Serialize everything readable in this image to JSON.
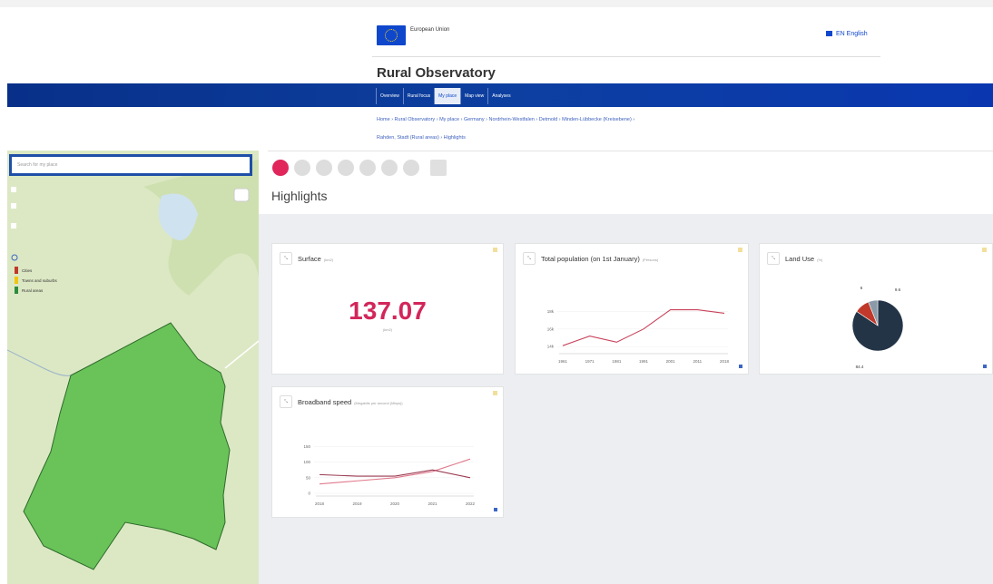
{
  "header": {
    "eu_label": "European Union",
    "language": "EN English",
    "site_title": "Rural Observatory"
  },
  "nav": {
    "items": [
      {
        "label": "Overview",
        "active": false
      },
      {
        "label": "Rural focus",
        "active": false
      },
      {
        "label": "My place",
        "active": true
      },
      {
        "label": "Map view",
        "active": false
      },
      {
        "label": "Analyses",
        "active": false
      }
    ]
  },
  "breadcrumb": {
    "line1": "Home › Rural Observatory › My place › Germany › Nordrhein-Westfalen › Detmold › Minden-Lübbecke (Kreisebene) ›",
    "line2": "Rahden, Stadt (Rural areas) › Highlights"
  },
  "search": {
    "placeholder": "Search for my place"
  },
  "map": {
    "legend": [
      {
        "label": "Cities",
        "color": "#c0392b"
      },
      {
        "label": "Towns and suburbs",
        "color": "#f1c40f"
      },
      {
        "label": "Rural areas",
        "color": "#2e8b3e"
      }
    ]
  },
  "section": {
    "title": "Highlights"
  },
  "cards": {
    "surface": {
      "title": "Surface",
      "unit": "(km2)",
      "value": "137.07",
      "value_unit": "(km2)"
    },
    "population": {
      "title": "Total population (on 1st January)",
      "unit": "(Persons)"
    },
    "landuse": {
      "title": "Land Use",
      "unit": "(%)"
    },
    "broadband": {
      "title": "Broadband speed",
      "unit": "(Megabits per second (Mbps))"
    }
  },
  "chart_data": [
    {
      "type": "line",
      "title": "Total population (on 1st January)",
      "ylabel": "",
      "x": [
        "1961",
        "1971",
        "1981",
        "1991",
        "2001",
        "2011",
        "2018"
      ],
      "series": [
        {
          "values": [
            14100,
            15200,
            14500,
            16000,
            18200,
            18200,
            17800
          ]
        }
      ],
      "yticks": [
        "14k",
        "16k",
        "18k"
      ],
      "ylim": [
        13500,
        19500
      ],
      "color": "#c9415b"
    },
    {
      "type": "pie",
      "title": "Land Use",
      "labels": [
        "84.4",
        "9.6",
        "6"
      ],
      "values": [
        84.4,
        9.6,
        6.0
      ],
      "colors": [
        "#243447",
        "#c0392b",
        "#8a9aa8"
      ]
    },
    {
      "type": "line",
      "title": "Broadband speed",
      "ylabel": "",
      "x": [
        "2018",
        "2019",
        "2020",
        "2021",
        "2022"
      ],
      "yticks": [
        "0",
        "50",
        "100",
        "150"
      ],
      "ylim": [
        0,
        160
      ],
      "series": [
        {
          "values": [
            30,
            40,
            50,
            70,
            110
          ],
          "color": "#e07a8c"
        },
        {
          "values": [
            60,
            55,
            55,
            75,
            50
          ],
          "color": "#9a3a52"
        }
      ]
    }
  ]
}
